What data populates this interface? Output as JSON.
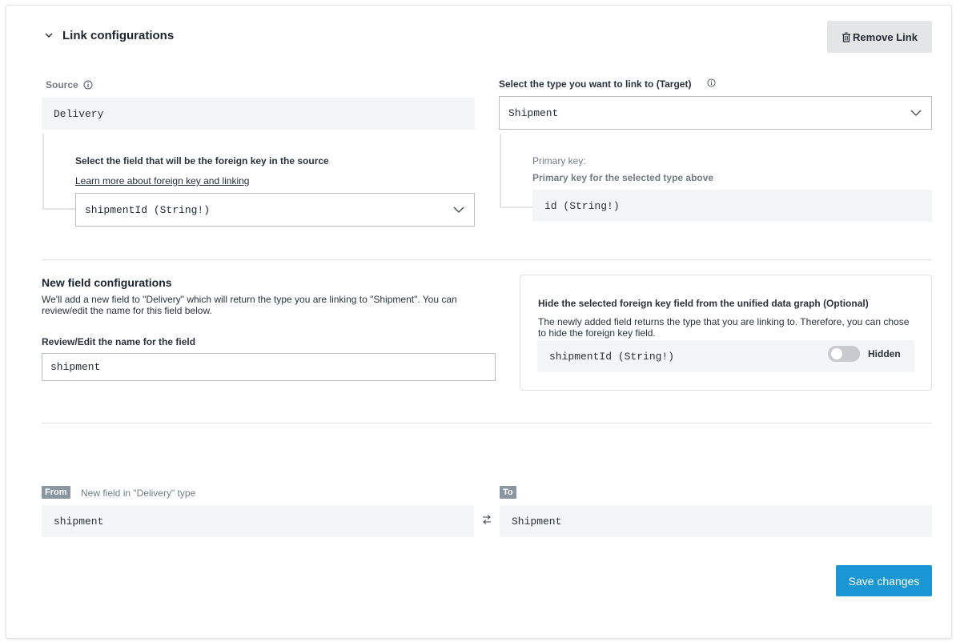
{
  "header": {
    "title": "Link configurations",
    "remove_button": "Remove Link"
  },
  "source": {
    "label": "Source",
    "value": "Delivery",
    "foreign_key_label": "Select the field that will be the foreign key in the source",
    "learn_more_link": "Learn more about foreign key and linking",
    "foreign_key_selected": "shipmentId (String!)"
  },
  "target": {
    "label": "Select the type you want to link to (Target)",
    "selected": "Shipment",
    "primary_key_label": "Primary key:",
    "primary_key_sub": "Primary key for the selected type above",
    "primary_key_value": "id (String!)"
  },
  "new_field": {
    "title": "New field configurations",
    "description": "We'll add a new field to \"Delivery\" which will return the type you are linking to \"Shipment\". You can review/edit the name for this field below.",
    "name_label": "Review/Edit the name for the field",
    "name_value": "shipment"
  },
  "hide_card": {
    "title": "Hide the selected foreign key field from the unified data graph (Optional)",
    "description": "The newly added field returns the type that you are linking to. Therefore, you can chose to hide the foreign key field.",
    "field_value": "shipmentId (String!)",
    "toggle_label": "Hidden",
    "toggle_on": false
  },
  "mapping": {
    "from_tag": "From",
    "from_caption": "New field in \"Delivery\" type",
    "from_value": "shipment",
    "to_tag": "To",
    "to_value": "Shipment"
  },
  "actions": {
    "save_label": "Save changes"
  },
  "colors": {
    "primary": "#1a96d4",
    "tag_bg": "#8a96a1",
    "readonly_bg": "#f4f5f6"
  }
}
